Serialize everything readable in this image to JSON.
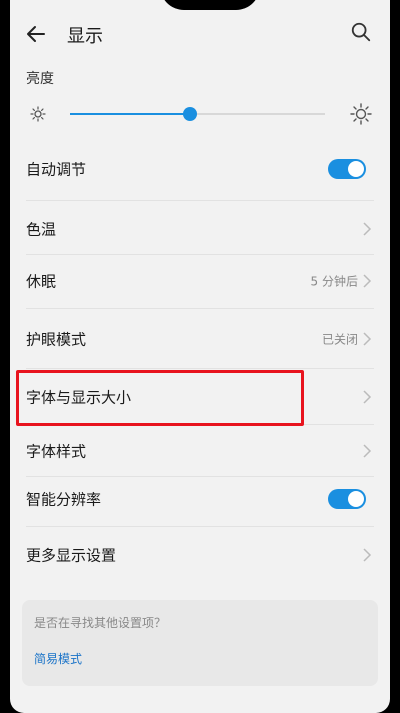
{
  "header": {
    "title": "显示"
  },
  "brightness": {
    "label": "亮度",
    "level_fraction": 0.47
  },
  "rows": [
    {
      "label": "自动调节",
      "value": "",
      "toggle": true
    },
    {
      "label": "色温",
      "value": ""
    },
    {
      "label": "休眠",
      "value": "5 分钟后"
    },
    {
      "label": "护眼模式",
      "value": "已关闭"
    },
    {
      "label": "字体与显示大小",
      "value": ""
    },
    {
      "label": "字体样式",
      "value": ""
    },
    {
      "label": "智能分辨率",
      "value": "",
      "toggle": true
    },
    {
      "label": "更多显示设置",
      "value": ""
    }
  ],
  "suggest": {
    "question": "是否在寻找其他设置项？",
    "link": "简易模式"
  },
  "colors": {
    "accent": "#1a8fe0",
    "highlight": "#e8141e"
  }
}
